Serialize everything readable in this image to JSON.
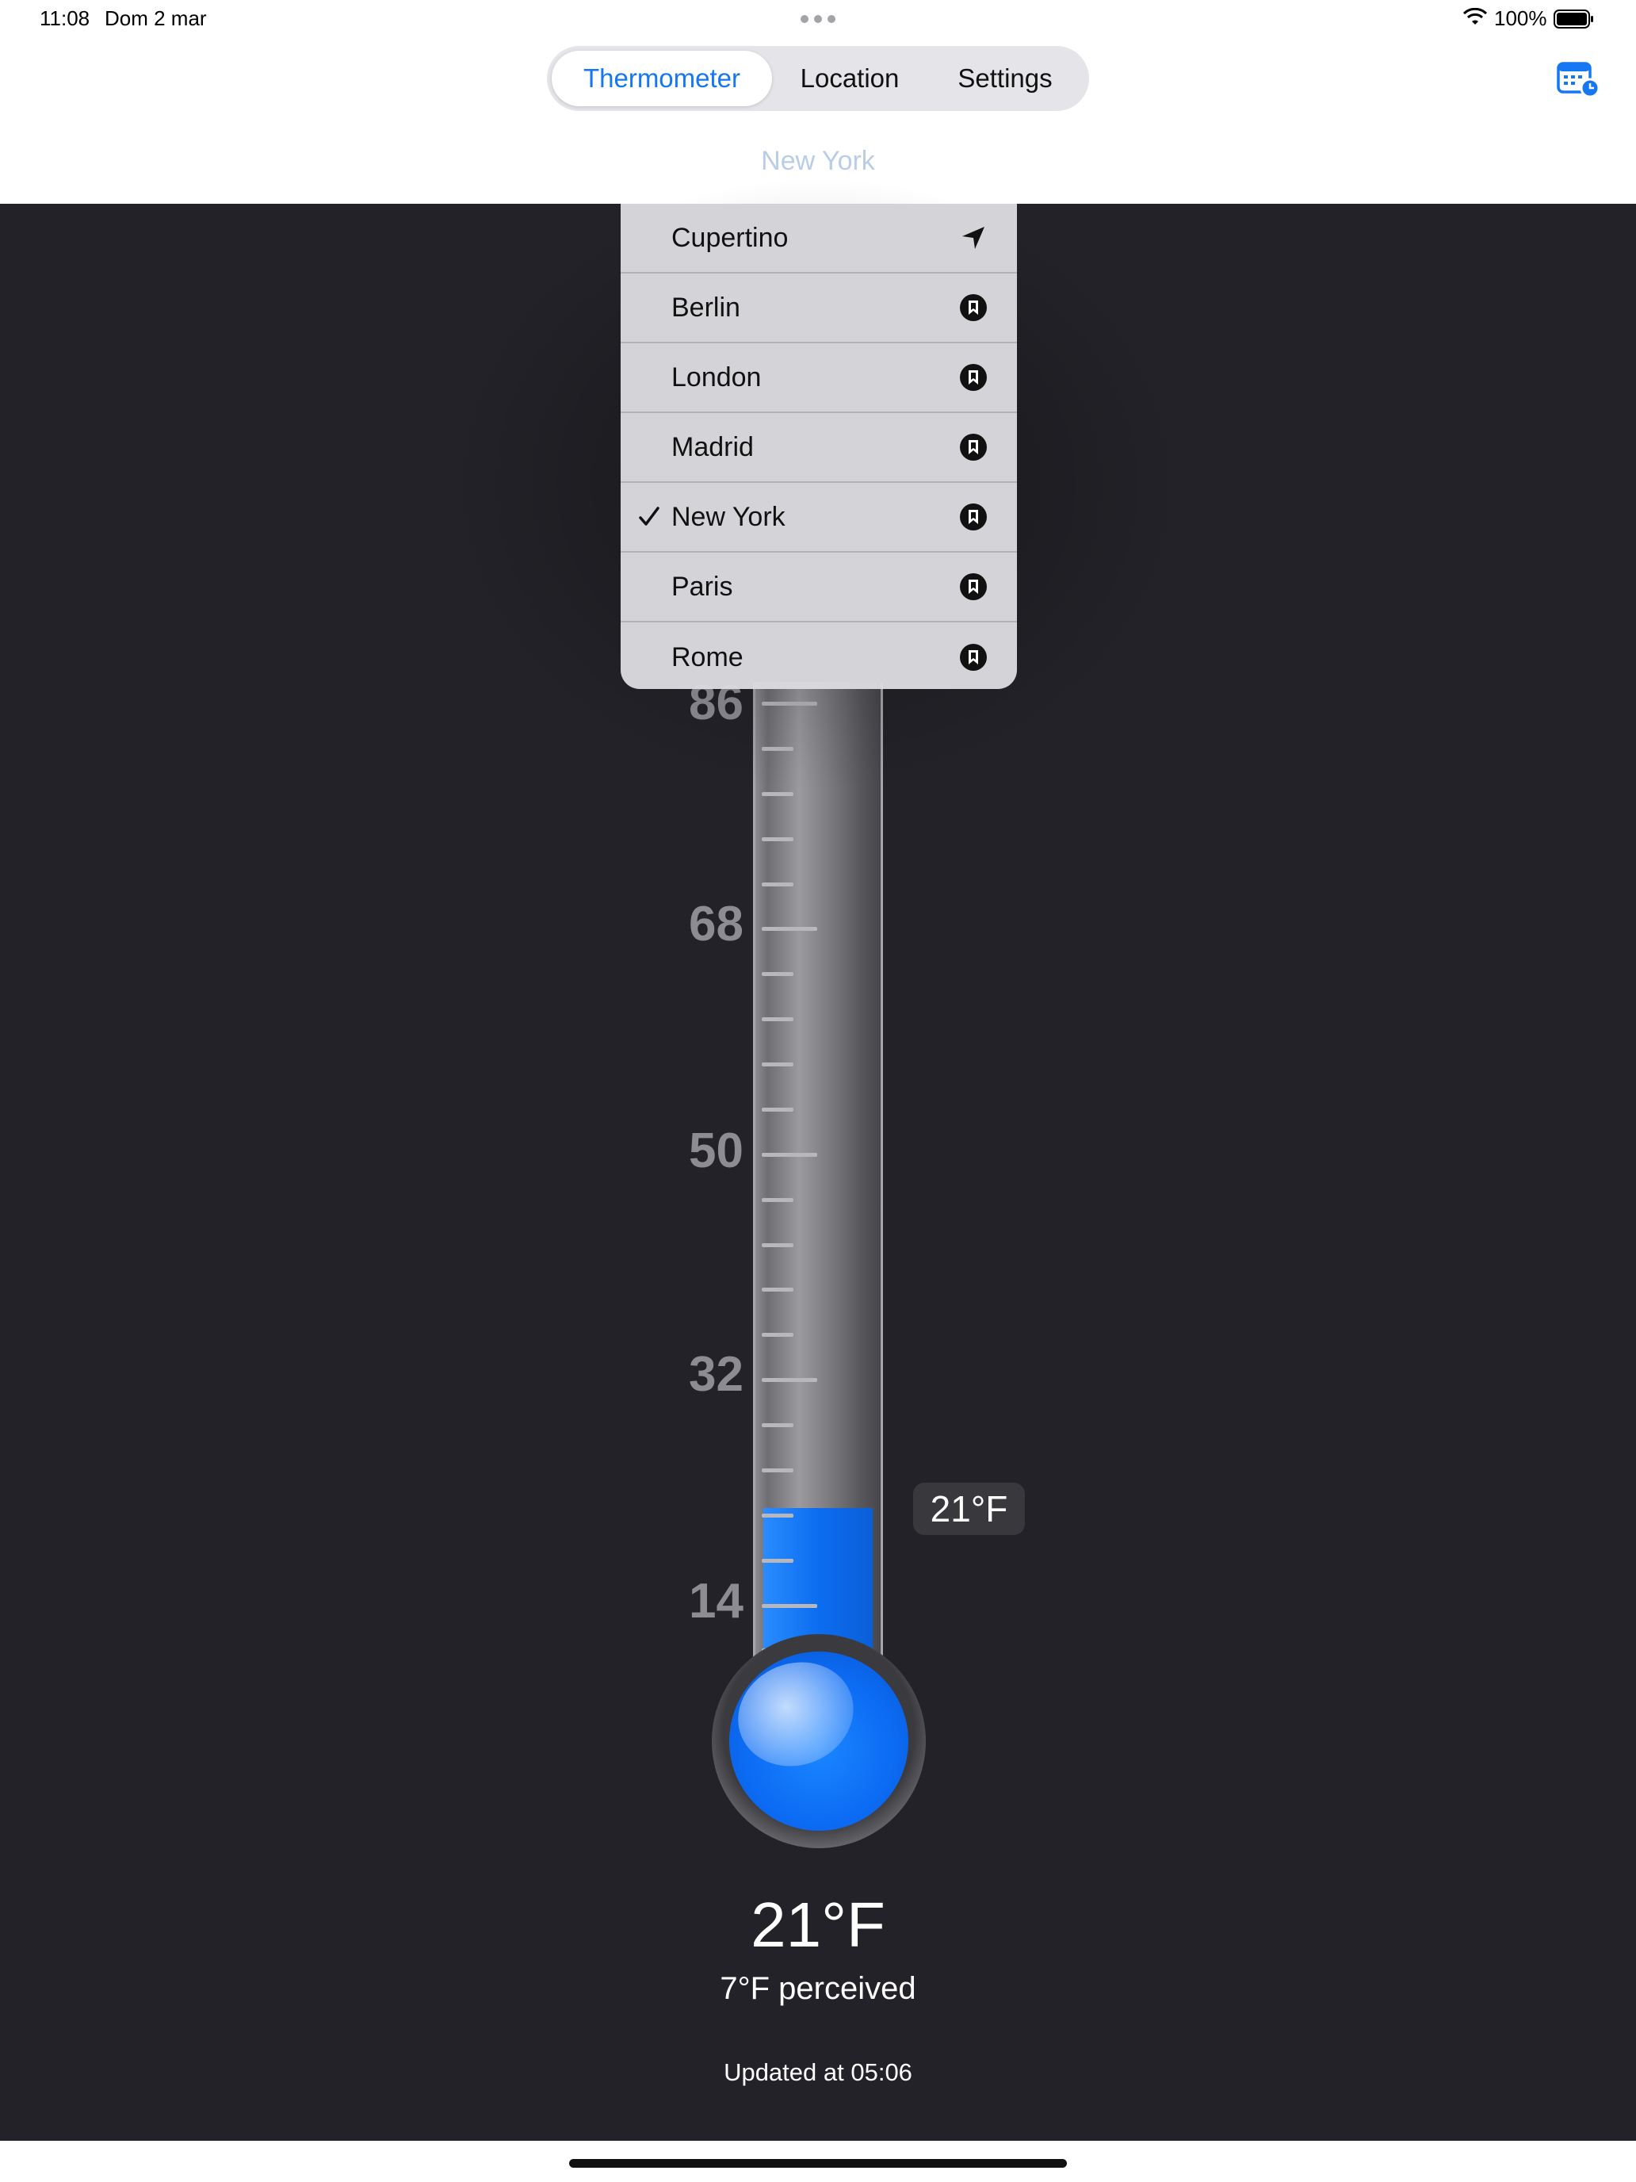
{
  "status_bar": {
    "time": "11:08",
    "date": "Dom 2 mar",
    "battery": "100%"
  },
  "tabs": [
    {
      "label": "Thermometer",
      "selected": true
    },
    {
      "label": "Location",
      "selected": false
    },
    {
      "label": "Settings",
      "selected": false
    }
  ],
  "location_title": "New York",
  "location_menu": {
    "items": [
      {
        "label": "Cupertino",
        "icon": "location-arrow-icon",
        "checked": false
      },
      {
        "label": "Berlin",
        "icon": "bookmark-icon",
        "checked": false
      },
      {
        "label": "London",
        "icon": "bookmark-icon",
        "checked": false
      },
      {
        "label": "Madrid",
        "icon": "bookmark-icon",
        "checked": false
      },
      {
        "label": "New York",
        "icon": "bookmark-icon",
        "checked": true
      },
      {
        "label": "Paris",
        "icon": "bookmark-icon",
        "checked": false
      },
      {
        "label": "Rome",
        "icon": "bookmark-icon",
        "checked": false
      }
    ]
  },
  "thermometer": {
    "scale_labels": [
      "86",
      "68",
      "50",
      "32",
      "14"
    ],
    "unit": "°F",
    "current_value": 21,
    "callout": "21°F"
  },
  "reading": {
    "temperature": "21°F",
    "perceived": "7°F perceived",
    "updated": "Updated at 05:06"
  },
  "colors": {
    "accent": "#1577f2",
    "fluid": "#0c6df0",
    "background": "#232228"
  }
}
